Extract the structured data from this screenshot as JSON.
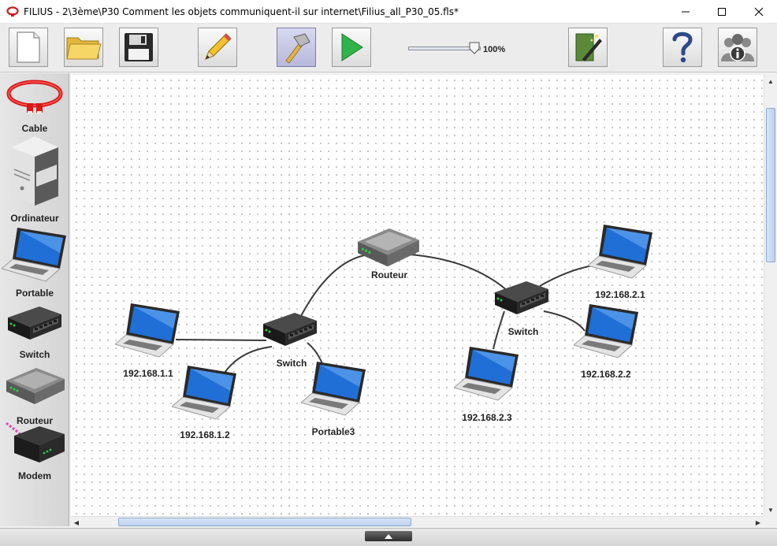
{
  "window": {
    "title": "FILIUS - 2\\3ème\\P30 Comment les objets communiquent-il sur internet\\Filius_all_P30_05.fls*",
    "minimize_glyph": "—",
    "maximize_glyph": "☐",
    "close_glyph": "✕"
  },
  "toolbar": {
    "buttons": [
      {
        "name": "new-file",
        "icon": "blank-document-icon"
      },
      {
        "name": "open-file",
        "icon": "folder-icon"
      },
      {
        "name": "save-file",
        "icon": "floppy-disk-icon"
      },
      {
        "name": "design-mode",
        "icon": "pencil-icon"
      },
      {
        "name": "build-mode",
        "icon": "hammer-icon",
        "active": true
      },
      {
        "name": "simulation-mode",
        "icon": "play-icon"
      },
      {
        "name": "wizard",
        "icon": "magic-wand-icon"
      },
      {
        "name": "help",
        "icon": "question-mark-icon"
      },
      {
        "name": "about",
        "icon": "info-group-icon"
      }
    ],
    "zoom_label": "100%"
  },
  "palette": {
    "items": [
      {
        "label": "Cable",
        "icon": "network-cable-icon"
      },
      {
        "label": "Ordinateur",
        "icon": "desktop-computer-icon"
      },
      {
        "label": "Portable",
        "icon": "laptop-icon"
      },
      {
        "label": "Switch",
        "icon": "switch-icon"
      },
      {
        "label": "Routeur",
        "icon": "router-icon"
      },
      {
        "label": "Modem",
        "icon": "modem-icon"
      }
    ]
  },
  "network": {
    "nodes": [
      {
        "id": "router",
        "type": "router",
        "label": "Routeur"
      },
      {
        "id": "switch1",
        "type": "switch",
        "label": "Switch"
      },
      {
        "id": "switch2",
        "type": "switch",
        "label": "Switch"
      },
      {
        "id": "pc11",
        "type": "laptop",
        "label": "192.168.1.1"
      },
      {
        "id": "pc12",
        "type": "laptop",
        "label": "192.168.1.2"
      },
      {
        "id": "portable3",
        "type": "laptop",
        "label": "Portable3"
      },
      {
        "id": "pc21",
        "type": "laptop",
        "label": "192.168.2.1"
      },
      {
        "id": "pc22",
        "type": "laptop",
        "label": "192.168.2.2"
      },
      {
        "id": "pc23",
        "type": "laptop",
        "label": "192.168.2.3"
      }
    ],
    "links": [
      [
        "pc11",
        "switch1"
      ],
      [
        "pc12",
        "switch1"
      ],
      [
        "portable3",
        "switch1"
      ],
      [
        "switch1",
        "router"
      ],
      [
        "router",
        "switch2"
      ],
      [
        "switch2",
        "pc21"
      ],
      [
        "switch2",
        "pc22"
      ],
      [
        "switch2",
        "pc23"
      ]
    ]
  },
  "colors": {
    "canvas_bg": "#ffffff",
    "grid_dot": "#b4b4b4",
    "cable": "#3a3a3a",
    "screen_blue": "#1f6fd6",
    "active_tool": "#c4c4e4"
  }
}
